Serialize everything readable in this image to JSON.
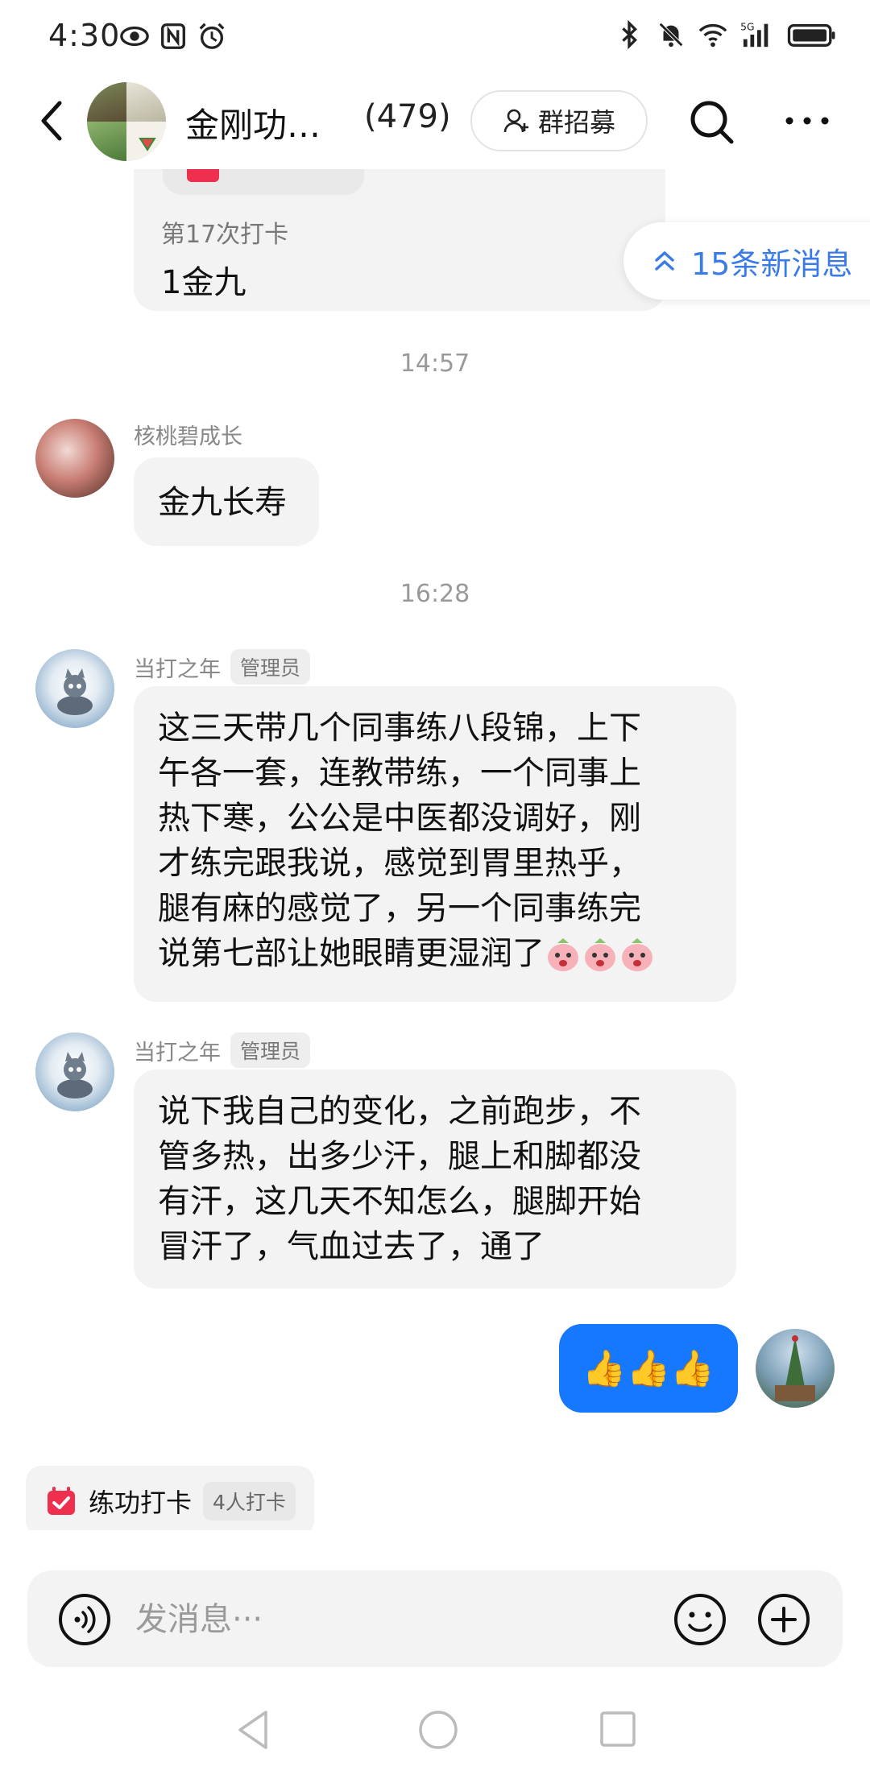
{
  "status_bar": {
    "time": "4:30",
    "left_icons": [
      "eye-icon",
      "nfc-icon",
      "alarm-icon"
    ],
    "right_icons": [
      "bluetooth-icon",
      "mute-icon",
      "wifi-icon",
      "signal-5g-icon",
      "battery-icon"
    ],
    "network": "5G"
  },
  "header": {
    "group_name": "金刚功…",
    "member_count": "(479)",
    "recruit_label": "群招募"
  },
  "new_messages": {
    "label": "15条新消息"
  },
  "messages": [
    {
      "type": "checkin_card_partial",
      "checkin_title": "第17次打卡",
      "checkin_text": "1金九"
    },
    {
      "type": "timestamp",
      "text": "14:57"
    },
    {
      "type": "incoming",
      "sender": "核桃碧成长",
      "text": "金九长寿"
    },
    {
      "type": "timestamp",
      "text": "16:28"
    },
    {
      "type": "incoming",
      "sender": "当打之年",
      "role_badge": "管理员",
      "lines": [
        "这三天带几个同事练八段锦，上下",
        "午各一套，连教带练，一个同事上",
        "热下寒，公公是中医都没调好，刚",
        "才练完跟我说，感觉到胃里热乎，",
        "腿有麻的感觉了，另一个同事练完",
        "说第七部让她眼睛更湿润了"
      ],
      "emoji_count": 3
    },
    {
      "type": "incoming",
      "sender": "当打之年",
      "role_badge": "管理员",
      "lines": [
        "说下我自己的变化，之前跑步，不",
        "管多热，出多少汗，腿上和脚都没",
        "有汗，这几天不知怎么，腿脚开始",
        "冒汗了，气血过去了，通了"
      ]
    },
    {
      "type": "outgoing",
      "text": "👍👍👍"
    }
  ],
  "checkin_chip": {
    "label": "练功打卡",
    "count": "4人打卡"
  },
  "input": {
    "placeholder": "发消息···"
  },
  "colors": {
    "accent": "#1677ff",
    "link": "#3b7be8",
    "bubble": "#f3f3f3",
    "checkin_red": "#ee2f4e"
  }
}
